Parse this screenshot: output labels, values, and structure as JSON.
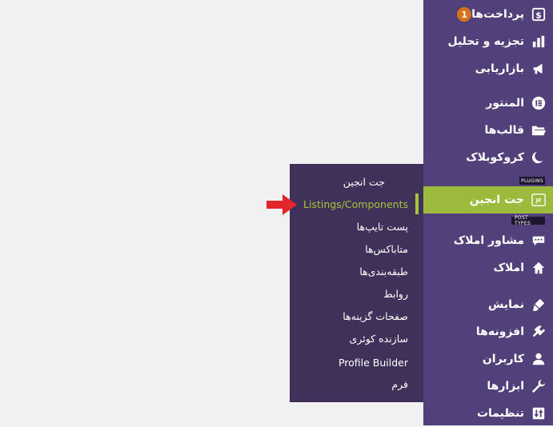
{
  "sidebar": {
    "items": [
      {
        "label": "پرداخت‌ها",
        "icon": "dollar-icon",
        "badge": "1"
      },
      {
        "label": "تجزیه و تحلیل",
        "icon": "bar-chart-icon"
      },
      {
        "label": "بازاریابی",
        "icon": "megaphone-icon"
      },
      {
        "label": "المنتور",
        "icon": "elementor-icon"
      },
      {
        "label": "قالب‌ها",
        "icon": "folder-icon"
      },
      {
        "label": "کروکوبلاک",
        "icon": "crescent-icon"
      },
      {
        "label": "جت انجین",
        "icon": "jet-engine-icon"
      },
      {
        "label": "مشاور املاک",
        "icon": "chat-bubble-icon"
      },
      {
        "label": "املاک",
        "icon": "home-icon"
      },
      {
        "label": "نمایش",
        "icon": "brush-icon"
      },
      {
        "label": "افزونه‌ها",
        "icon": "plugin-icon"
      },
      {
        "label": "کاربران",
        "icon": "user-icon"
      },
      {
        "label": "ابزارها",
        "icon": "wrench-icon"
      },
      {
        "label": "تنظیمات",
        "icon": "settings-icon"
      }
    ],
    "section_plugins": "PLUGINS",
    "section_post_types": "POST TYPES"
  },
  "submenu": {
    "items": [
      {
        "label": "جت انجین"
      },
      {
        "label": "Listings/Components",
        "current": true
      },
      {
        "label": "پست تایپ‌ها"
      },
      {
        "label": "متاباکس‌ها"
      },
      {
        "label": "طبقه‌بندی‌ها"
      },
      {
        "label": "روابط"
      },
      {
        "label": "صفحات گزینه‌ها"
      },
      {
        "label": "سازنده کوئری"
      },
      {
        "label": "Profile Builder"
      },
      {
        "label": "فرم"
      }
    ]
  },
  "colors": {
    "sidebar_bg": "#52407a",
    "submenu_bg": "#3f3159",
    "accent": "#9cba3c",
    "badge": "#d6731e",
    "arrow": "#e3262d"
  }
}
